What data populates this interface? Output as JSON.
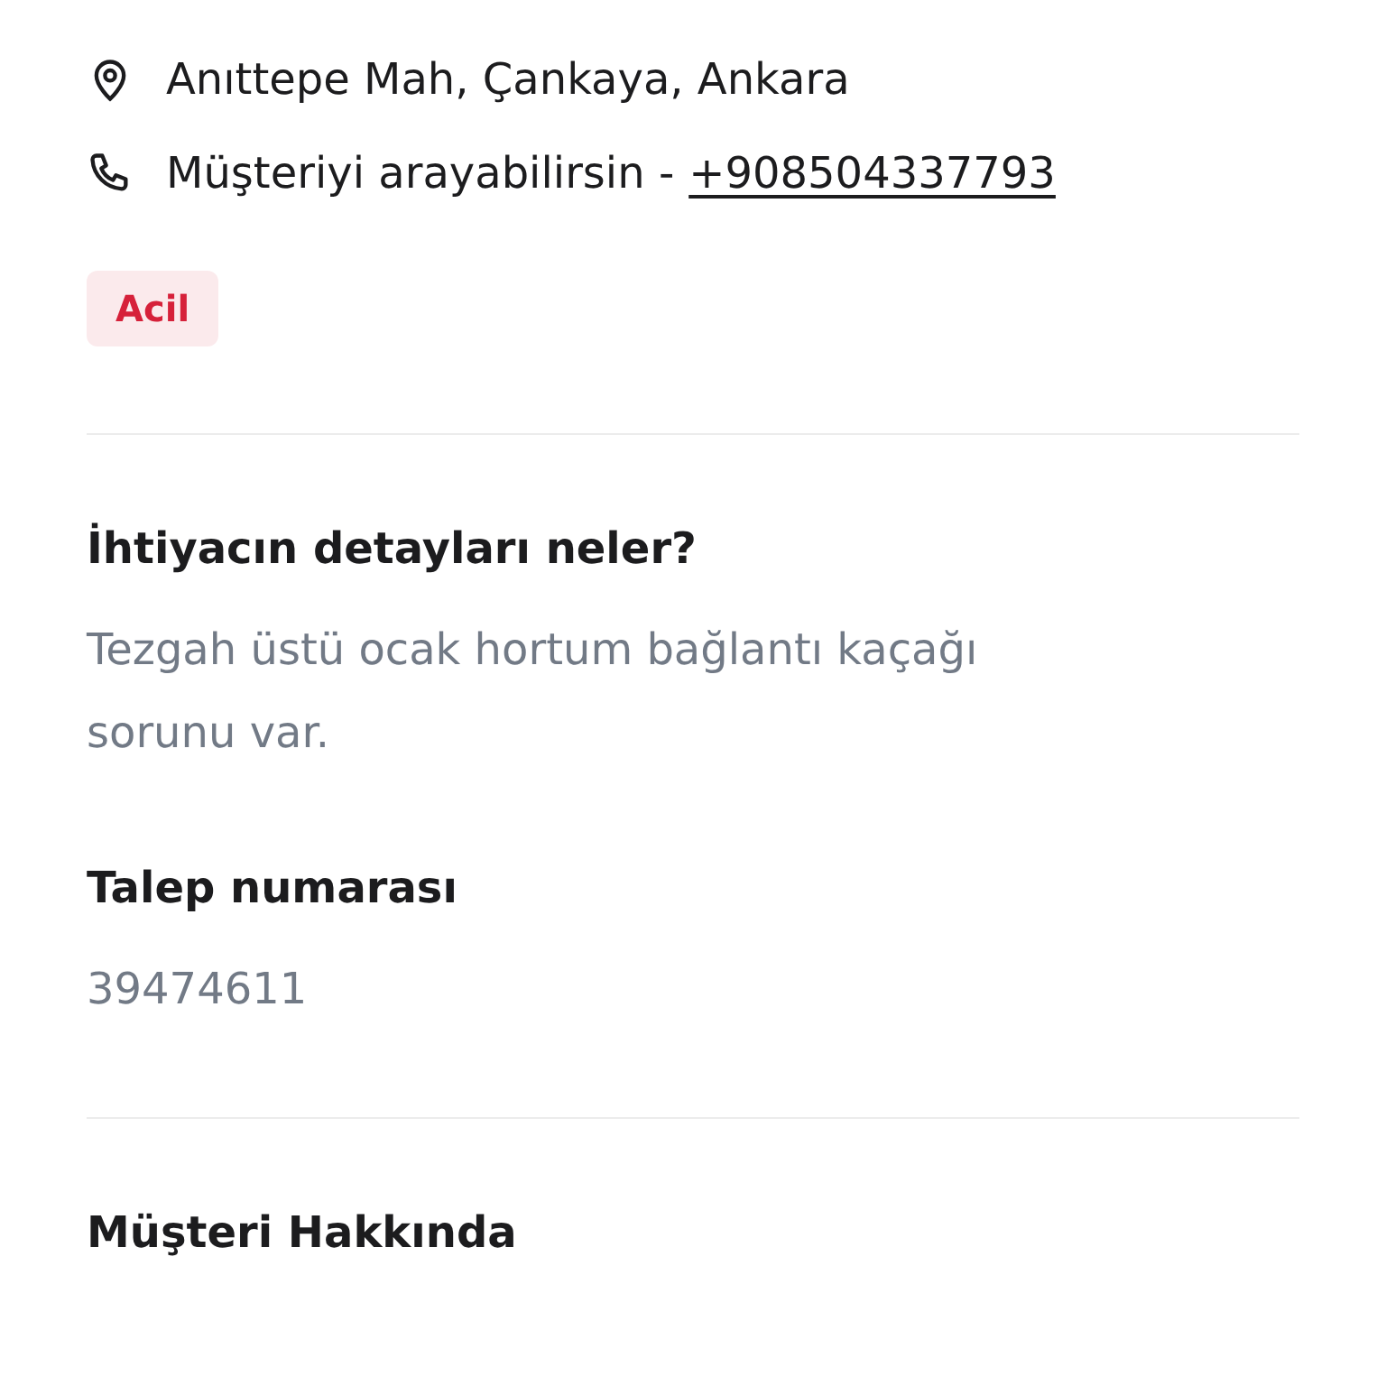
{
  "contact": {
    "address": "Anıttepe Mah, Çankaya, Ankara",
    "phone_label": "Müşteriyi arayabilirsin -",
    "phone": "+908504337793"
  },
  "tags": [
    {
      "label": "Acil",
      "color": "#d6213a"
    }
  ],
  "sections": [
    {
      "title": "İhtiyacın detayları neler?",
      "text": "Tezgah üstü ocak hortum bağlantı kaçağı sorunu var.",
      "divider_after": false
    },
    {
      "title": "Talep numarası",
      "text": "39474611",
      "divider_after": true
    },
    {
      "title": "Müşteri Hakkında",
      "divider_after": false
    }
  ]
}
